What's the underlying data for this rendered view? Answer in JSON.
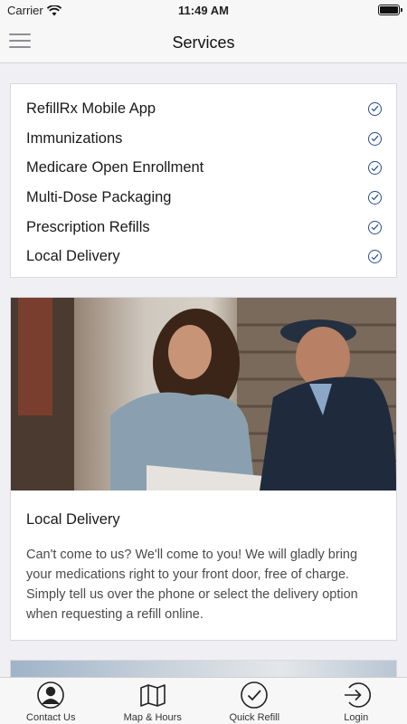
{
  "status_bar": {
    "carrier": "Carrier",
    "time": "11:49 AM"
  },
  "nav": {
    "title": "Services"
  },
  "services": [
    {
      "label": "RefillRx Mobile App"
    },
    {
      "label": "Immunizations"
    },
    {
      "label": "Medicare Open Enrollment"
    },
    {
      "label": "Multi-Dose Packaging"
    },
    {
      "label": "Prescription Refills"
    },
    {
      "label": "Local Delivery"
    }
  ],
  "feature_card": {
    "title": "Local Delivery",
    "body": "Can't come to us? We'll come to you! We will gladly bring your medications right to your front door, free of charge. Simply tell us over the phone or select the delivery option when requesting a refill online."
  },
  "tab_bar": {
    "contact": "Contact Us",
    "map": "Map & Hours",
    "refill": "Quick Refill",
    "login": "Login"
  },
  "colors": {
    "accent": "#2a4c8f"
  }
}
